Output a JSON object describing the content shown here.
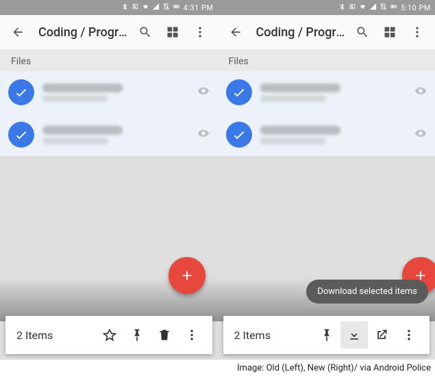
{
  "caption": "Image: Old (Left), New (Right)/ via Android Police",
  "left": {
    "status_time": "4:31 PM",
    "toolbar_title": "Coding / Progra...",
    "section_label": "Files",
    "selection_count": "2 Items"
  },
  "right": {
    "status_time": "5:10 PM",
    "toolbar_title": "Coding / Progra...",
    "section_label": "Files",
    "selection_count": "2 Items",
    "tooltip": "Download selected items"
  },
  "colors": {
    "accent": "#3a78e7",
    "fab": "#e7483b"
  }
}
